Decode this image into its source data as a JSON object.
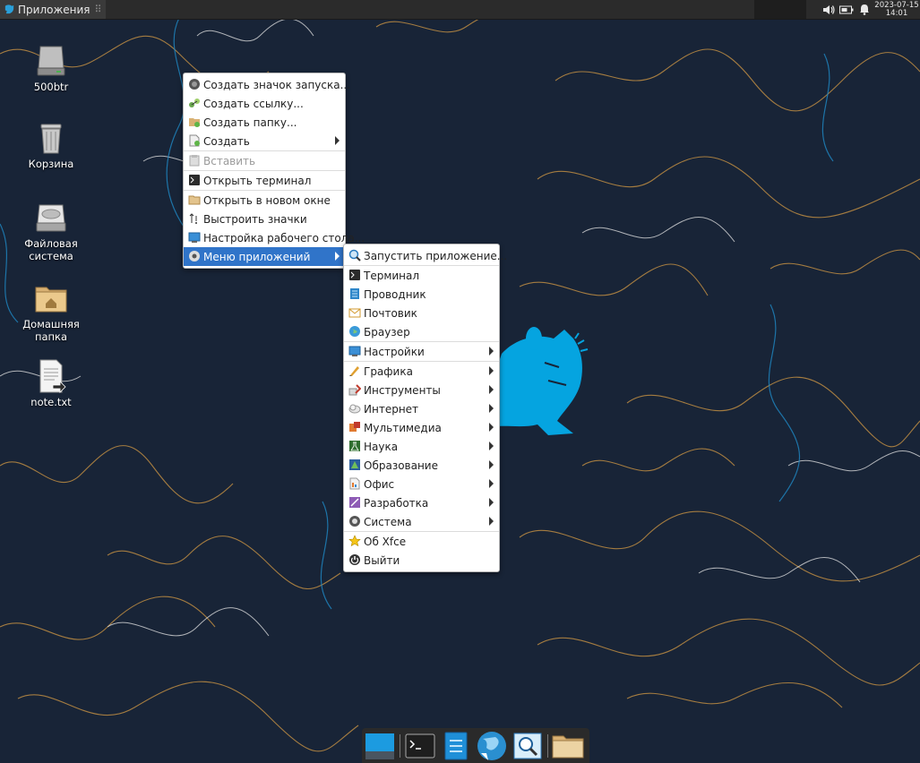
{
  "panel": {
    "apps_label": "Приложения",
    "clock_date": "2023-07-15",
    "clock_time": "14:01",
    "tray_icons": [
      "volume-icon",
      "battery-icon",
      "notification-bell-icon"
    ]
  },
  "desktop": {
    "icons": [
      {
        "label": "500btr",
        "icon": "drive-icon"
      },
      {
        "label": "Корзина",
        "icon": "trash-icon"
      },
      {
        "label": "Файловая система",
        "icon": "filesystem-icon"
      },
      {
        "label": "Домашняя папка",
        "icon": "home-folder-icon"
      },
      {
        "label": "note.txt",
        "icon": "text-file-icon"
      }
    ]
  },
  "context_menu": {
    "items": [
      {
        "label": "Создать значок запуска...",
        "icon": "launcher-icon"
      },
      {
        "label": "Создать ссылку...",
        "icon": "link-icon"
      },
      {
        "label": "Создать папку...",
        "icon": "folder-new-icon"
      },
      {
        "label": "Создать",
        "icon": "document-new-icon",
        "submenu": true
      },
      {
        "label": "Вставить",
        "icon": "paste-icon",
        "disabled": true
      },
      {
        "label": "Открыть терминал",
        "icon": "terminal-icon"
      },
      {
        "label": "Открыть в новом окне",
        "icon": "folder-icon"
      },
      {
        "label": "Выстроить значки",
        "icon": "arrange-icon"
      },
      {
        "label": "Настройка рабочего стола...",
        "icon": "desktop-settings-icon"
      },
      {
        "label": "Меню приложений",
        "icon": "app-menu-icon",
        "submenu": true,
        "active": true
      }
    ]
  },
  "app_menu": {
    "items": [
      {
        "label": "Запустить приложение...",
        "icon": "run-icon"
      },
      {
        "label": "Терминал",
        "icon": "terminal-icon"
      },
      {
        "label": "Проводник",
        "icon": "file-manager-icon"
      },
      {
        "label": "Почтовик",
        "icon": "mail-icon"
      },
      {
        "label": "Браузер",
        "icon": "browser-icon"
      },
      {
        "label": "Настройки",
        "icon": "settings-icon",
        "submenu": true
      },
      {
        "label": "Графика",
        "icon": "graphics-icon",
        "submenu": true
      },
      {
        "label": "Инструменты",
        "icon": "tools-icon",
        "submenu": true
      },
      {
        "label": "Интернет",
        "icon": "internet-icon",
        "submenu": true
      },
      {
        "label": "Мультимедиа",
        "icon": "multimedia-icon",
        "submenu": true
      },
      {
        "label": "Наука",
        "icon": "science-icon",
        "submenu": true
      },
      {
        "label": "Образование",
        "icon": "education-icon",
        "submenu": true
      },
      {
        "label": "Офис",
        "icon": "office-icon",
        "submenu": true
      },
      {
        "label": "Разработка",
        "icon": "development-icon",
        "submenu": true
      },
      {
        "label": "Система",
        "icon": "system-icon",
        "submenu": true
      },
      {
        "label": "Об Xfce",
        "icon": "about-star-icon"
      },
      {
        "label": "Выйти",
        "icon": "logout-icon"
      }
    ]
  },
  "dock": {
    "items": [
      "show-desktop-icon",
      "terminal-icon",
      "file-manager-icon",
      "browser-icon",
      "app-finder-icon",
      "folder-icon"
    ]
  },
  "colors": {
    "wallpaper": "#182437",
    "accent_blue": "#05a4e0",
    "contour_orange": "#d99b3f",
    "menu_highlight": "#3074c9"
  }
}
